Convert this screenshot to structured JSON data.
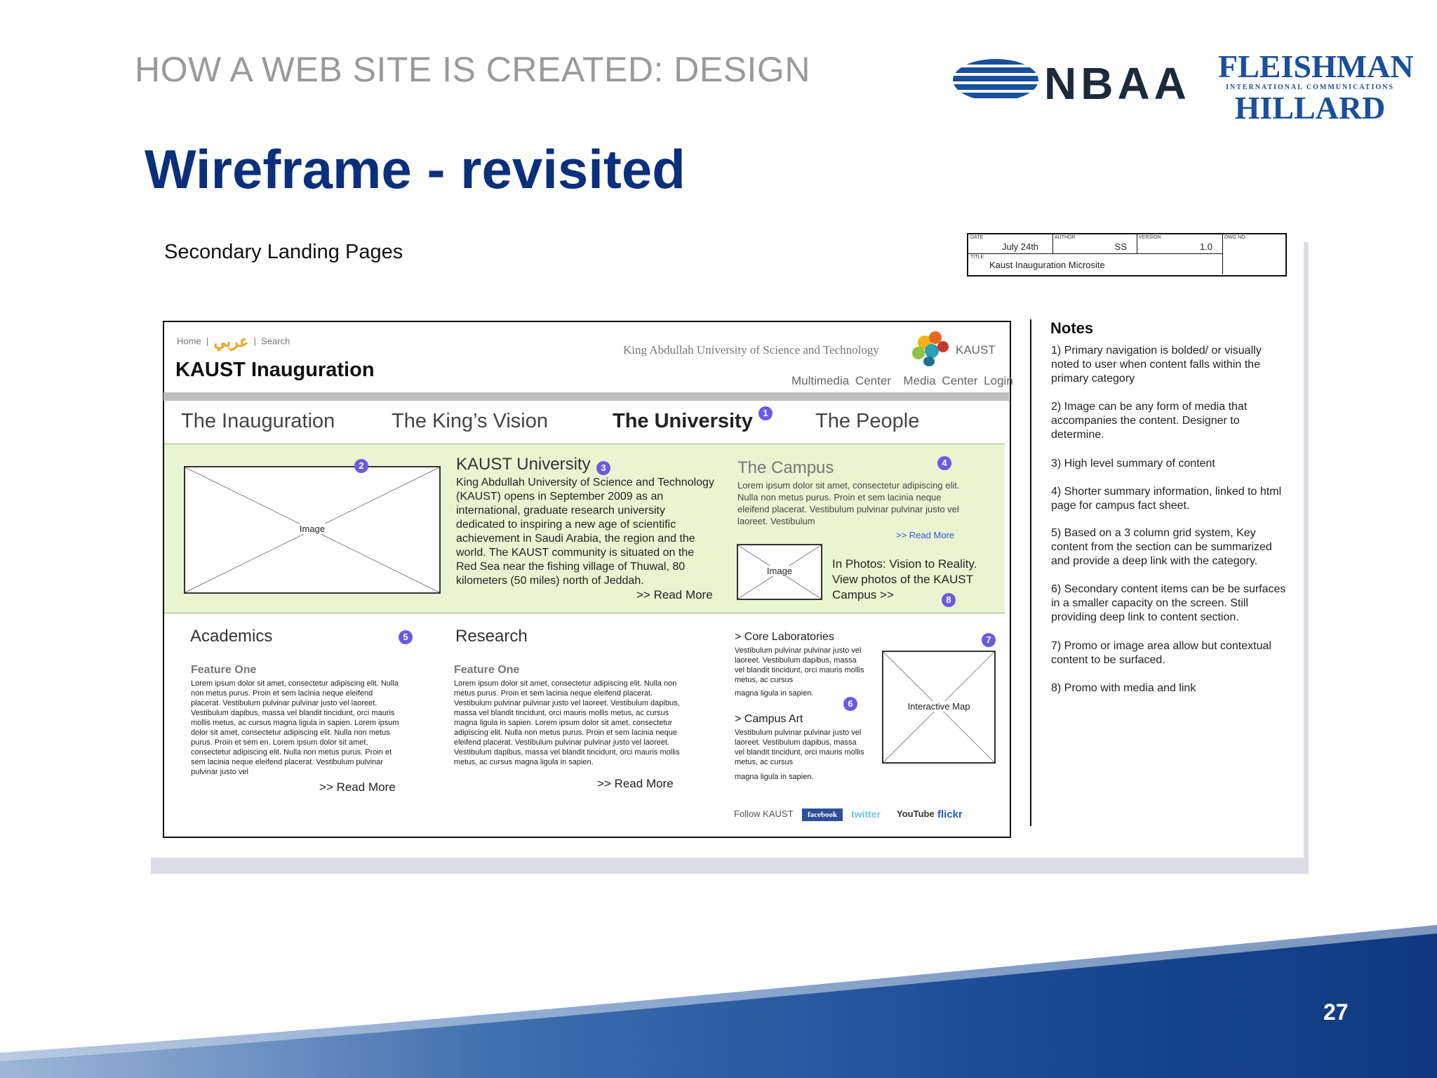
{
  "slide": {
    "kicker": "HOW A WEB SITE IS CREATED: DESIGN",
    "title": "Wireframe - revisited",
    "page_number": "27"
  },
  "logos": {
    "nbaa": "NBAA",
    "fh_line1": "FLEISHMAN",
    "fh_line2": "INTERNATIONAL COMMUNICATIONS",
    "fh_line3": "HILLARD"
  },
  "sheet": {
    "label": "Secondary Landing Pages",
    "title_block": {
      "date_label": "DATE",
      "date": "July 24th",
      "author_label": "AUTHOR",
      "author": "SS",
      "version_label": "VERSION",
      "version": "1.0",
      "dwg_label": "DWG NO.",
      "title_label": "TITLE",
      "title": "Kaust Inauguration Microsite"
    }
  },
  "wireframe": {
    "utility": {
      "home": "Home",
      "sep": "|",
      "arabic": "عربي",
      "search": "Search"
    },
    "site_title": "KAUST Inauguration",
    "university_name": "King Abdullah University of Science and Technology",
    "kaust_word": "KAUST",
    "header_links": [
      "Multimedia Center",
      "Media Center Login"
    ],
    "nav": [
      {
        "label": "The Inauguration",
        "active": false
      },
      {
        "label": "The King’s Vision",
        "active": false
      },
      {
        "label": "The University",
        "active": true
      },
      {
        "label": "The People",
        "active": false
      }
    ],
    "badges": [
      "1",
      "2",
      "3",
      "4",
      "5",
      "6",
      "7",
      "8"
    ],
    "feature_image_caption": "Image",
    "kaust_university": {
      "heading": "KAUST University",
      "body": "King Abdullah University of Science and Technology (KAUST) opens in September 2009 as an international, graduate research university dedicated to inspiring a new age of scientific achievement in Saudi Arabia, the region and the world. The KAUST community is situated on the Red Sea near the fishing village of Thuwal, 80 kilometers (50 miles) north of Jeddah.",
      "read_more": ">> Read More"
    },
    "campus": {
      "heading": "The Campus",
      "body": "Lorem ipsum dolor sit amet, consectetur adipiscing elit. Nulla non metus purus. Proin et sem lacinia neque eleifend placerat. Vestibulum pulvinar pulvinar justo vel laoreet. Vestibulum",
      "read_more": ">> Read More",
      "image_caption": "Image",
      "promo": "In Photos: Vision to Reality. View photos of the KAUST Campus >>"
    },
    "academics": {
      "heading": "Academics",
      "feature": "Feature One",
      "body": "Lorem ipsum dolor sit amet, consectetur adipiscing elit. Nulla non metus purus. Proin et sem lacinia neque eleifend placerat. Vestibulum pulvinar pulvinar justo vel laoreet. Vestibulum dapibus, massa vel blandit tincidunt, orci mauris mollis metus, ac cursus magna ligula in sapien. Lorem ipsum dolor sit amet, consectetur adipiscing elit. Nulla non metus purus. Proin et sem en. Lorem ipsum dolor sit amet, consectetur adipiscing elit. Nulla non metus purus. Proin et sem lacinia neque eleifend placerat. Vestibulum pulvinar pulvinar justo vel",
      "read_more": ">> Read More"
    },
    "research": {
      "heading": "Research",
      "feature": "Feature One",
      "body": "Lorem ipsum dolor sit amet, consectetur adipiscing elit. Nulla non metus purus. Proin et sem lacinia neque eleifend placerat. Vestibulum pulvinar pulvinar justo vel laoreet. Vestibulum dapibus, massa vel blandit tincidunt, orci mauris mollis metus, ac cursus magna ligula in sapien. Lorem ipsum dolor sit amet, consectetur adipiscing elit. Nulla non metus purus. Proin et sem lacinia neque eleifend placerat. Vestibulum pulvinar pulvinar justo vel laoreet. Vestibulum dapibus, massa vel blandit tincidunt, orci mauris mollis metus, ac cursus magna ligula in sapien.",
      "read_more": ">> Read More"
    },
    "core_labs": {
      "heading": "> Core Laboratories",
      "body": "Vestibulum pulvinar pulvinar justo vel laoreet. Vestibulum dapibus, massa vel blandit tincidunt, orci mauris mollis metus, ac cursus",
      "tail": "magna ligula in sapien."
    },
    "campus_art": {
      "heading": "> Campus Art",
      "body": "Vestibulum pulvinar pulvinar justo vel laoreet. Vestibulum dapibus, massa vel blandit tincidunt, orci mauris mollis metus, ac cursus",
      "tail": "magna ligula in sapien."
    },
    "map_caption": "Interactive Map",
    "follow": {
      "label": "Follow KAUST",
      "facebook": "facebook",
      "twitter": "twitter",
      "youtube": "YouTube",
      "flickr": "flickr"
    }
  },
  "notes": {
    "title": "Notes",
    "items": [
      "1) Primary navigation is bolded/ or visually noted to user when content falls within the primary category",
      "2) Image can be any form of media that accompanies the content. Designer to determine.",
      "3) High level summary of content",
      "4) Shorter summary information, linked to html page for campus fact sheet.",
      "5) Based on a 3 column grid system, Key content from the section can be summarized and provide a deep link with the category.",
      "6) Secondary content items can be be surfaces in a smaller capacity on the screen. Still providing deep link to content section.",
      "7) Promo or image area allow but contextual content to be surfaced.",
      "8) Promo with media and link"
    ]
  },
  "colors": {
    "title_blue": "#0b2f7c",
    "badge_purple": "#6a5be0",
    "highlight_green": "#e9f5d2",
    "link_blue": "#3355dd"
  }
}
